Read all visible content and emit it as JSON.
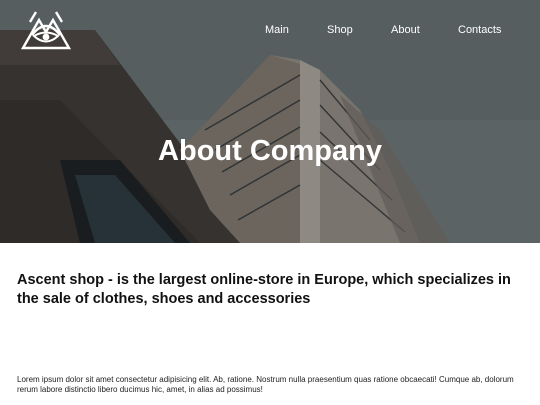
{
  "header": {
    "logo_icon": "eye-triangle-icon",
    "nav": [
      {
        "label": "Main"
      },
      {
        "label": "Shop"
      },
      {
        "label": "About"
      },
      {
        "label": "Contacts"
      }
    ]
  },
  "hero": {
    "title": "About Company"
  },
  "content": {
    "intro": "Ascent shop - is the largest online-store in Europe, which specializes in the sale of clothes, shoes and accessories",
    "body": "Lorem ipsum dolor sit amet consectetur adipisicing elit. Ab, ratione. Nostrum nulla praesentium quas ratione obcaecati! Cumque ab, dolorum rerum labore distinctio libero ducimus hic, amet, in alias ad possimus!"
  }
}
